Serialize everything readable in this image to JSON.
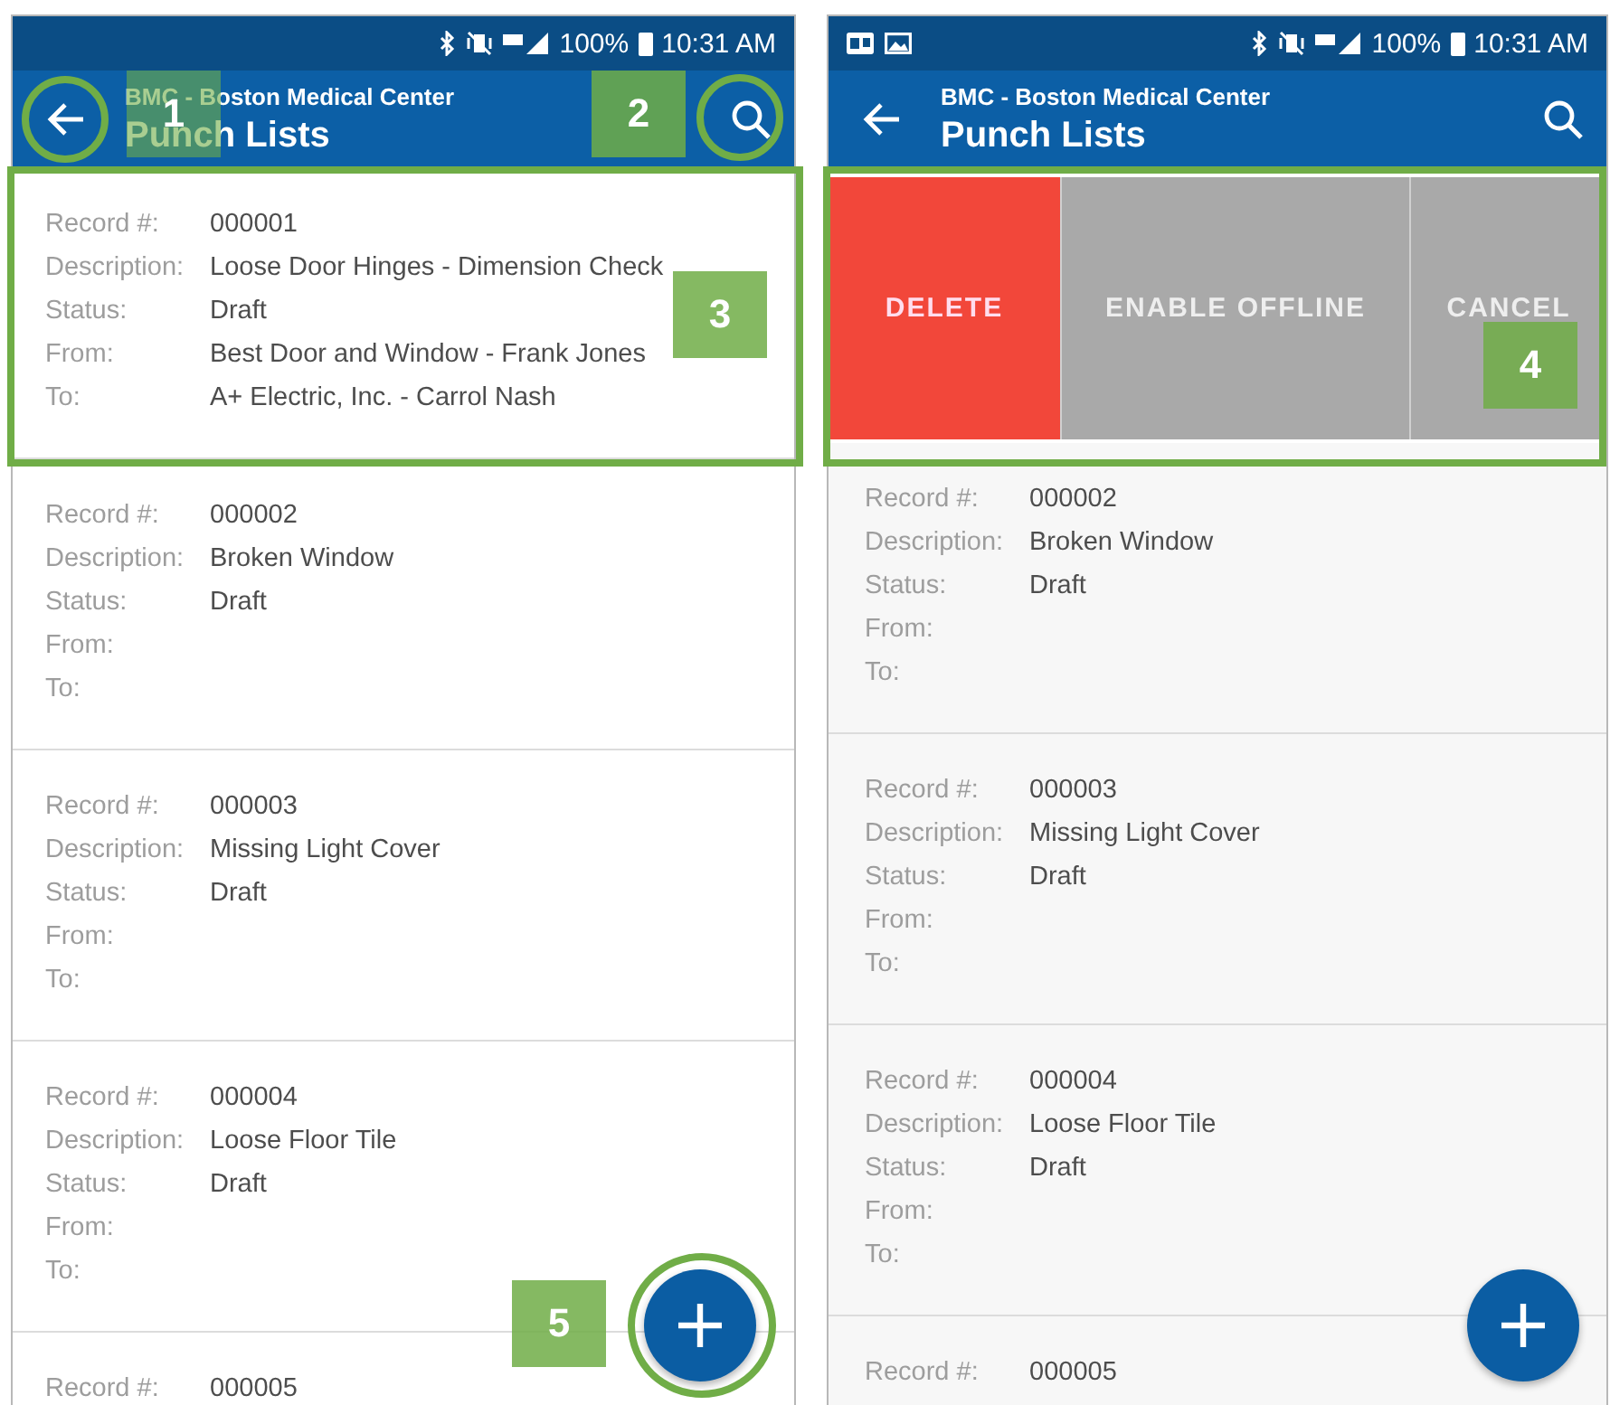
{
  "screens": [
    {
      "status_bar": {
        "notification_icons": false,
        "battery": "100%",
        "time": "10:31 AM"
      },
      "app_bar": {
        "subtitle": "BMC - Boston Medical Center",
        "title": "Punch Lists",
        "back_callout": "1",
        "search_callout": "2"
      },
      "add_callout": "5",
      "records": [
        {
          "callout": "3",
          "fields": [
            {
              "label": "Record #:",
              "value": "000001"
            },
            {
              "label": "Description:",
              "value": "Loose Door Hinges - Dimension Check"
            },
            {
              "label": "Status:",
              "value": "Draft"
            },
            {
              "label": "From:",
              "value": "Best Door and Window - Frank Jones"
            },
            {
              "label": "To:",
              "value": "A+ Electric, Inc. - Carrol Nash"
            }
          ]
        },
        {
          "fields": [
            {
              "label": "Record #:",
              "value": "000002"
            },
            {
              "label": "Description:",
              "value": "Broken Window"
            },
            {
              "label": "Status:",
              "value": "Draft"
            },
            {
              "label": "From:"
            },
            {
              "label": "To:"
            }
          ]
        },
        {
          "fields": [
            {
              "label": "Record #:",
              "value": "000003"
            },
            {
              "label": "Description:",
              "value": "Missing Light Cover"
            },
            {
              "label": "Status:",
              "value": "Draft"
            },
            {
              "label": "From:"
            },
            {
              "label": "To:"
            }
          ]
        },
        {
          "fields": [
            {
              "label": "Record #:",
              "value": "000004"
            },
            {
              "label": "Description:",
              "value": "Loose Floor Tile"
            },
            {
              "label": "Status:",
              "value": "Draft"
            },
            {
              "label": "From:"
            },
            {
              "label": "To:"
            }
          ]
        },
        {
          "fields": [
            {
              "label": "Record #:",
              "value": "000005"
            }
          ]
        }
      ]
    },
    {
      "status_bar": {
        "notification_icons": true,
        "battery": "100%",
        "time": "10:31 AM"
      },
      "app_bar": {
        "subtitle": "BMC - Boston Medical Center",
        "title": "Punch Lists"
      },
      "swipe_actions_callout": "4",
      "swipe_actions": [
        {
          "label": "DELETE",
          "kind": "delete"
        },
        {
          "label": "ENABLE OFFLINE",
          "kind": "neutral"
        },
        {
          "label": "CANCEL",
          "kind": "neutral"
        }
      ],
      "records": [
        {
          "fields": [
            {
              "label": "Record #:",
              "value": "000002"
            },
            {
              "label": "Description:",
              "value": "Broken Window"
            },
            {
              "label": "Status:",
              "value": "Draft"
            },
            {
              "label": "From:"
            },
            {
              "label": "To:"
            }
          ]
        },
        {
          "fields": [
            {
              "label": "Record #:",
              "value": "000003"
            },
            {
              "label": "Description:",
              "value": "Missing Light Cover"
            },
            {
              "label": "Status:",
              "value": "Draft"
            },
            {
              "label": "From:"
            },
            {
              "label": "To:"
            }
          ]
        },
        {
          "fields": [
            {
              "label": "Record #:",
              "value": "000004"
            },
            {
              "label": "Description:",
              "value": "Loose Floor Tile"
            },
            {
              "label": "Status:",
              "value": "Draft"
            },
            {
              "label": "From:"
            },
            {
              "label": "To:"
            }
          ]
        },
        {
          "fields": [
            {
              "label": "Record #:",
              "value": "000005"
            }
          ]
        }
      ]
    }
  ]
}
